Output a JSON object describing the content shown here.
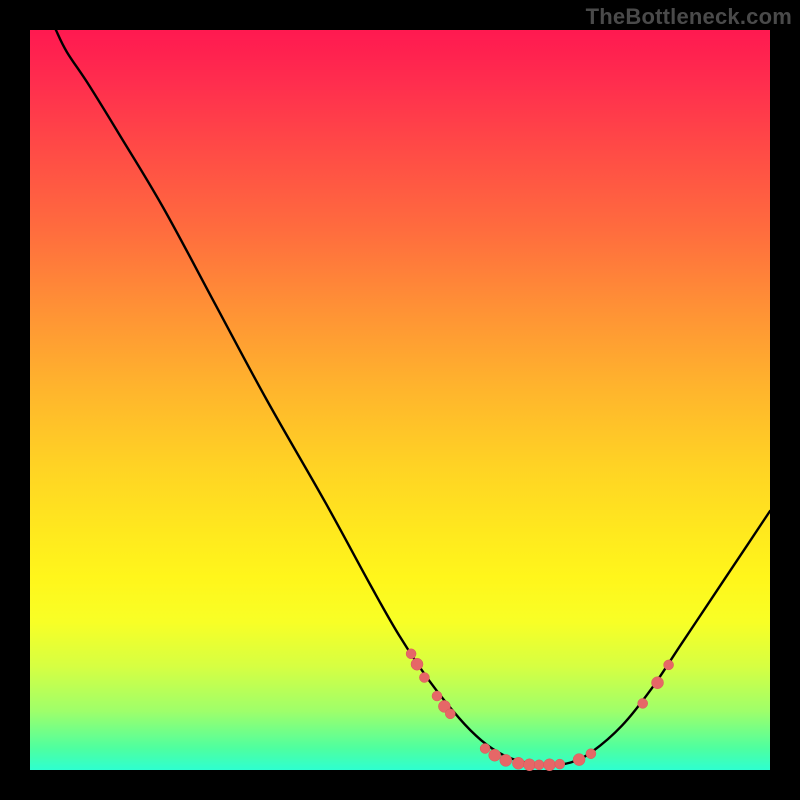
{
  "watermark": "TheBottleneck.com",
  "colors": {
    "page_bg": "#000000",
    "watermark": "#4a4a4a",
    "curve": "#000000",
    "point_fill": "#e66767"
  },
  "chart_data": {
    "type": "line",
    "title": "",
    "xlabel": "",
    "ylabel": "",
    "xlim": [
      0,
      100
    ],
    "ylim": [
      0,
      100
    ],
    "curve": [
      {
        "x": 3.5,
        "y": 100
      },
      {
        "x": 5,
        "y": 97
      },
      {
        "x": 8,
        "y": 92.5
      },
      {
        "x": 12,
        "y": 86
      },
      {
        "x": 18,
        "y": 76
      },
      {
        "x": 25,
        "y": 63
      },
      {
        "x": 32,
        "y": 50
      },
      {
        "x": 40,
        "y": 36
      },
      {
        "x": 46,
        "y": 25
      },
      {
        "x": 50,
        "y": 18
      },
      {
        "x": 54,
        "y": 12
      },
      {
        "x": 58,
        "y": 7
      },
      {
        "x": 61,
        "y": 4
      },
      {
        "x": 64,
        "y": 2
      },
      {
        "x": 67,
        "y": 1
      },
      {
        "x": 70,
        "y": 0.7
      },
      {
        "x": 73,
        "y": 1
      },
      {
        "x": 76,
        "y": 2.5
      },
      {
        "x": 80,
        "y": 6
      },
      {
        "x": 84,
        "y": 11
      },
      {
        "x": 88,
        "y": 17
      },
      {
        "x": 92,
        "y": 23
      },
      {
        "x": 96,
        "y": 29
      },
      {
        "x": 100,
        "y": 35
      }
    ],
    "points": [
      {
        "x": 51.5,
        "y": 15.7,
        "r": 5
      },
      {
        "x": 52.3,
        "y": 14.3,
        "r": 6
      },
      {
        "x": 53.3,
        "y": 12.5,
        "r": 5
      },
      {
        "x": 55.0,
        "y": 10.0,
        "r": 5
      },
      {
        "x": 56.0,
        "y": 8.6,
        "r": 6
      },
      {
        "x": 56.8,
        "y": 7.6,
        "r": 5
      },
      {
        "x": 61.5,
        "y": 2.9,
        "r": 5
      },
      {
        "x": 62.8,
        "y": 2.0,
        "r": 6
      },
      {
        "x": 64.3,
        "y": 1.3,
        "r": 6
      },
      {
        "x": 66.0,
        "y": 0.9,
        "r": 6
      },
      {
        "x": 67.5,
        "y": 0.7,
        "r": 6
      },
      {
        "x": 68.8,
        "y": 0.7,
        "r": 5
      },
      {
        "x": 70.2,
        "y": 0.7,
        "r": 6
      },
      {
        "x": 71.6,
        "y": 0.8,
        "r": 5
      },
      {
        "x": 74.2,
        "y": 1.4,
        "r": 6
      },
      {
        "x": 75.8,
        "y": 2.2,
        "r": 5
      },
      {
        "x": 82.8,
        "y": 9.0,
        "r": 5
      },
      {
        "x": 84.8,
        "y": 11.8,
        "r": 6
      },
      {
        "x": 86.3,
        "y": 14.2,
        "r": 5
      }
    ]
  }
}
